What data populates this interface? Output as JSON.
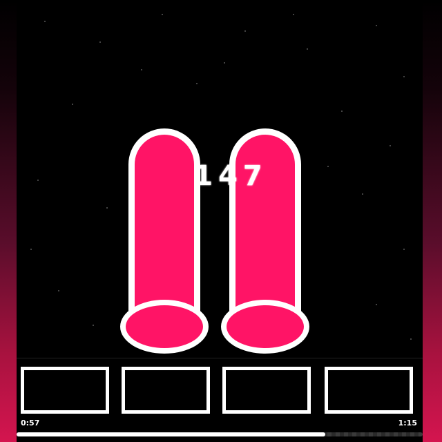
{
  "game": {
    "score": "147",
    "tube_color": "#ff1466",
    "outline_color": "#ffffff",
    "background_color": "#000000",
    "tubes": [
      "pink-tube",
      "pink-tube"
    ],
    "tiles": [
      "empty-tile",
      "empty-tile",
      "empty-tile",
      "empty-tile"
    ]
  },
  "player": {
    "elapsed": "0:57",
    "total": "1:15",
    "progress": 0.76
  }
}
